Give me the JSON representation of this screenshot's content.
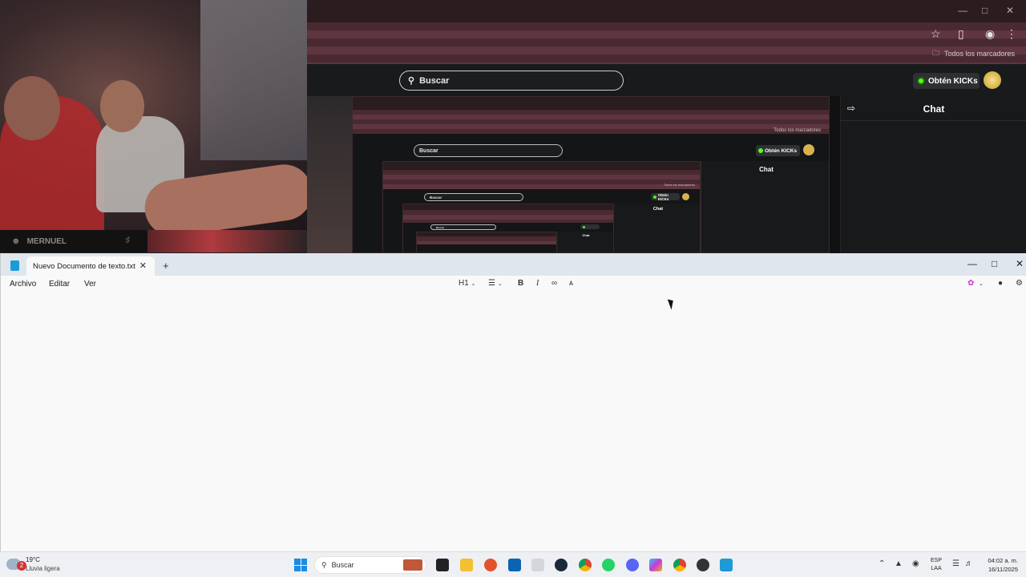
{
  "webcam": {
    "username": "MERNUEL"
  },
  "browser": {
    "bookmarks_label": "Todos los marcadores",
    "search_placeholder": "Buscar",
    "kicks_button": "Obtén KICKs",
    "chat_title": "Chat"
  },
  "notepad": {
    "tab_title": "Nuevo Documento de texto.txt",
    "menus": [
      "Archivo",
      "Editar",
      "Ver"
    ],
    "heading_selector": "H1",
    "toolbar": {
      "bold": "B",
      "italic": "I"
    }
  },
  "taskbar": {
    "weather_temp": "19°C",
    "weather_condition": "Lluvia ligera",
    "weather_badge": "2",
    "search_placeholder": "Buscar",
    "language": "ESP",
    "keyboard": "LAA",
    "time": "04:02 a. m.",
    "date": "16/11/2025"
  },
  "colors": {
    "kick_green": "#53fc18",
    "browser_theme": "#5e3540",
    "windows_accent": "#1a8ce3"
  }
}
